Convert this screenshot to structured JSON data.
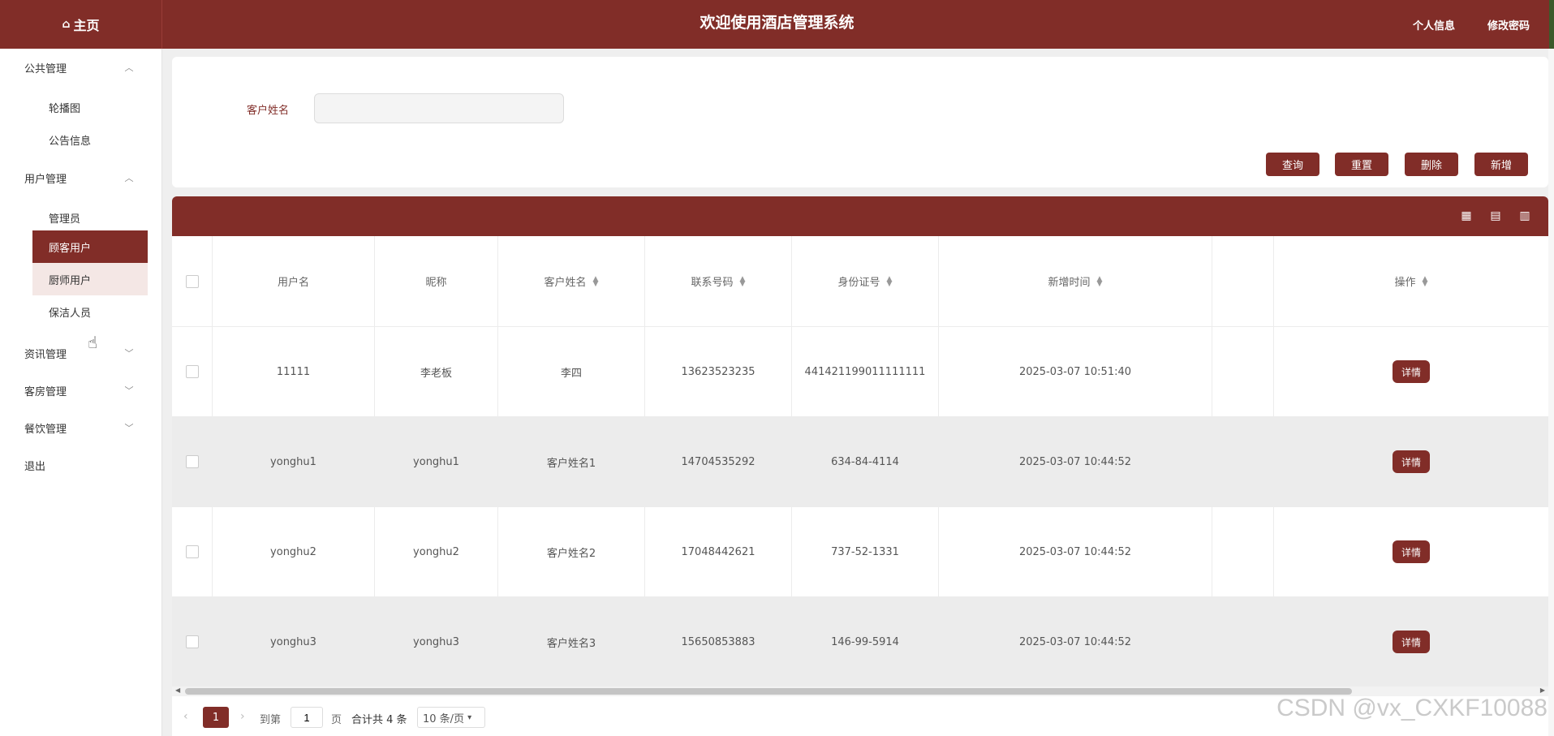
{
  "header": {
    "home_label": "主页",
    "title": "欢迎使用酒店管理系统",
    "profile_label": "个人信息",
    "change_password_label": "修改密码"
  },
  "sidebar": {
    "groups": [
      {
        "label": "公共管理",
        "expanded": true,
        "items": [
          "轮播图",
          "公告信息"
        ]
      },
      {
        "label": "用户管理",
        "expanded": true,
        "items": [
          "管理员",
          "顾客用户",
          "厨师用户",
          "保洁人员"
        ]
      },
      {
        "label": "资讯管理",
        "expanded": false
      },
      {
        "label": "客房管理",
        "expanded": false
      },
      {
        "label": "餐饮管理",
        "expanded": false
      },
      {
        "label": "退出"
      }
    ],
    "active_item": "顾客用户",
    "hover_item": "厨师用户"
  },
  "search": {
    "label": "客户姓名",
    "value": "",
    "placeholder": ""
  },
  "buttons": {
    "query": "查询",
    "reset": "重置",
    "delete": "删除",
    "add": "新增"
  },
  "table": {
    "columns": [
      "用户名",
      "昵称",
      "客户姓名",
      "联系号码",
      "身份证号",
      "新增时间",
      "",
      "操作"
    ],
    "rows": [
      {
        "username": "11111",
        "nickname": "李老板",
        "name": "李四",
        "phone": "13623523235",
        "id_number": "441421199011111111",
        "created": "2025-03-07 10:51:40",
        "action": "详情"
      },
      {
        "username": "yonghu1",
        "nickname": "yonghu1",
        "name": "客户姓名1",
        "phone": "14704535292",
        "id_number": "634-84-4114",
        "created": "2025-03-07 10:44:52",
        "action": "详情"
      },
      {
        "username": "yonghu2",
        "nickname": "yonghu2",
        "name": "客户姓名2",
        "phone": "17048442621",
        "id_number": "737-52-1331",
        "created": "2025-03-07 10:44:52",
        "action": "详情"
      },
      {
        "username": "yonghu3",
        "nickname": "yonghu3",
        "name": "客户姓名3",
        "phone": "15650853883",
        "id_number": "146-99-5914",
        "created": "2025-03-07 10:44:52",
        "action": "详情"
      }
    ]
  },
  "pagination": {
    "current_page": "1",
    "goto_label": "到第",
    "goto_value": "1",
    "page_unit": "页",
    "total_label": "合计共 4 条",
    "page_size": "10 条/页"
  },
  "watermark": "CSDN @vx_CXKF10088",
  "colors": {
    "primary": "#812d28",
    "background": "#efefef",
    "row_alt": "#ececec"
  }
}
